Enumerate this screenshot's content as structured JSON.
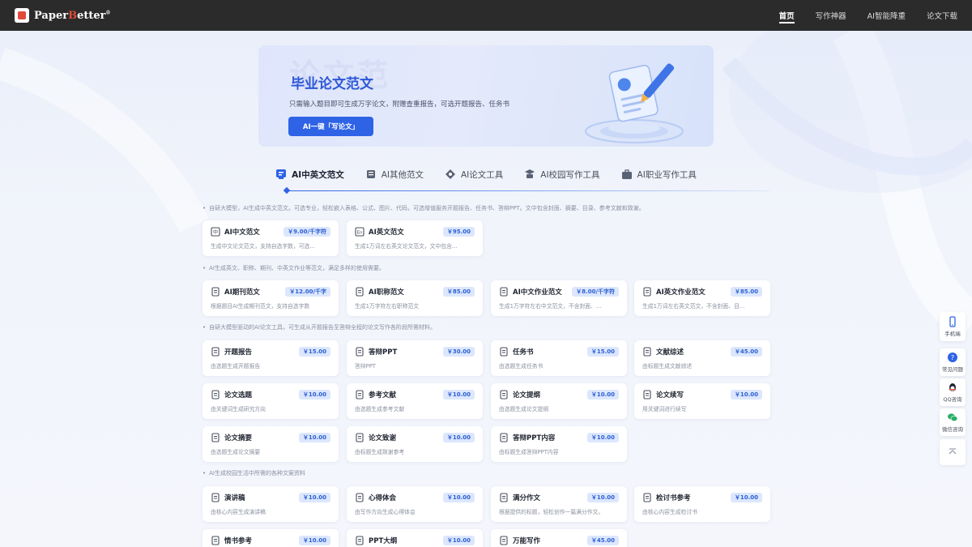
{
  "header": {
    "logo_text_a": "Paper",
    "logo_text_b": "B",
    "logo_text_c": "etter",
    "logo_reg": "®",
    "nav": [
      {
        "label": "首页",
        "active": true
      },
      {
        "label": "写作神器",
        "active": false
      },
      {
        "label": "AI智能降重",
        "active": false
      },
      {
        "label": "论文下载",
        "active": false
      }
    ]
  },
  "banner": {
    "ghost": "论文范",
    "title": "毕业论文范文",
    "subtitle": "只需输入题目即可生成万字论文，附赠查重报告，可选开题报告、任务书",
    "button": "AI一键「写论文」"
  },
  "tabs": [
    {
      "label": "AI中英文范文",
      "icon": "doc-ai-icon",
      "active": true
    },
    {
      "label": "AI其他范文",
      "icon": "stack-icon",
      "active": false
    },
    {
      "label": "AI论文工具",
      "icon": "tools-icon",
      "active": false
    },
    {
      "label": "AI校园写作工具",
      "icon": "campus-icon",
      "active": false
    },
    {
      "label": "AI职业写作工具",
      "icon": "briefcase-icon",
      "active": false
    }
  ],
  "notes": {
    "n1": "自研大模型，AI生成中英文范文。可选专业，轻松嵌入表格、公式、图片、代码，可选增值服务开题报告、任务书、答辩PPT。文中包含封面、摘要、目录、参考文献和致谢。",
    "n2": "AI生成英文、职称、期刊、中英文作业等范文，满足多样的使用需要。",
    "n3": "自研大模型驱动的AI论文工具，可生成从开题报告至答辩全程的论文写作各阶段所需材料。",
    "n4": "AI生成校园生活中所需的各种文案资料"
  },
  "cards": {
    "c1": {
      "title": "AI中文范文",
      "price": "￥9.00/千字符",
      "desc": "生成中文论文范文，支持自选字数，可选...",
      "icon": "zh-icon"
    },
    "c2": {
      "title": "AI英文范文",
      "price": "￥95.00",
      "desc": "生成1万词左右英文论文范文，文中包含...",
      "icon": "en-icon"
    },
    "c3": {
      "title": "AI期刊范文",
      "price": "￥12.00/千字",
      "desc": "根据题目AI生成期刊范文，支持自选字数",
      "icon": "journal-icon"
    },
    "c4": {
      "title": "AI职称范文",
      "price": "￥85.00",
      "desc": "生成1万字符左右职称范文",
      "icon": "thermo-icon"
    },
    "c5": {
      "title": "AI中文作业范文",
      "price": "￥8.00/千字符",
      "desc": "生成1万字符左右中文范文，不含封面、...",
      "icon": "edit-doc-icon"
    },
    "c6": {
      "title": "AI英文作业范文",
      "price": "￥85.00",
      "desc": "生成1万词左右英文范文，不含封面、目...",
      "icon": "translate-icon"
    },
    "c7": {
      "title": "开题报告",
      "price": "￥15.00",
      "desc": "由选题生成开题报告",
      "icon": "report-icon"
    },
    "c8": {
      "title": "答辩PPT",
      "price": "￥30.00",
      "desc": "答辩PPT",
      "icon": "globe-icon"
    },
    "c9": {
      "title": "任务书",
      "price": "￥15.00",
      "desc": "由选题生成任务书",
      "icon": "list-icon"
    },
    "c10": {
      "title": "文献综述",
      "price": "￥45.00",
      "desc": "由标题生成文献综述",
      "icon": "book-icon"
    },
    "c11": {
      "title": "论文选题",
      "price": "￥10.00",
      "desc": "由关键词生成研究方向",
      "icon": "topic-icon"
    },
    "c12": {
      "title": "参考文献",
      "price": "￥10.00",
      "desc": "由选题生成参考文献",
      "icon": "refs-icon"
    },
    "c13": {
      "title": "论文提纲",
      "price": "￥10.00",
      "desc": "由选题生成论文提纲",
      "icon": "outline-icon"
    },
    "c14": {
      "title": "论文续写",
      "price": "￥10.00",
      "desc": "用关键词进行续写",
      "icon": "loop-icon"
    },
    "c15": {
      "title": "论文摘要",
      "price": "￥10.00",
      "desc": "由选题生成论文摘要",
      "icon": "abstract-icon"
    },
    "c16": {
      "title": "论文致谢",
      "price": "￥10.00",
      "desc": "由标题生成致谢参考",
      "icon": "heart-icon"
    },
    "c17": {
      "title": "答辩PPT内容",
      "price": "￥10.00",
      "desc": "由标题生成答辩PPT内容",
      "icon": "globe-icon"
    },
    "c18": {
      "title": "演讲稿",
      "price": "￥10.00",
      "desc": "由核心内容生成演讲稿",
      "icon": "speech-icon"
    },
    "c19": {
      "title": "心得体会",
      "price": "￥10.00",
      "desc": "由写作方向生成心得体会",
      "icon": "smile-icon"
    },
    "c20": {
      "title": "满分作文",
      "price": "￥10.00",
      "desc": "根据提供的标题，轻松创作一篇满分作文。",
      "icon": "essay-icon"
    },
    "c21": {
      "title": "检讨书参考",
      "price": "￥10.00",
      "desc": "由核心内容生成检讨书",
      "icon": "review-icon"
    },
    "c22": {
      "title": "情书参考",
      "price": "￥10.00",
      "desc": "",
      "icon": "love-letter-icon"
    },
    "c23": {
      "title": "PPT大纲",
      "price": "￥10.00",
      "desc": "",
      "icon": "globe-icon"
    },
    "c24": {
      "title": "万能写作",
      "price": "￥45.00",
      "desc": "",
      "icon": "infinity-icon"
    }
  },
  "side": {
    "mobile": "手机端",
    "faq": "常见问题",
    "qq": "QQ咨询",
    "wechat": "微信咨询"
  }
}
